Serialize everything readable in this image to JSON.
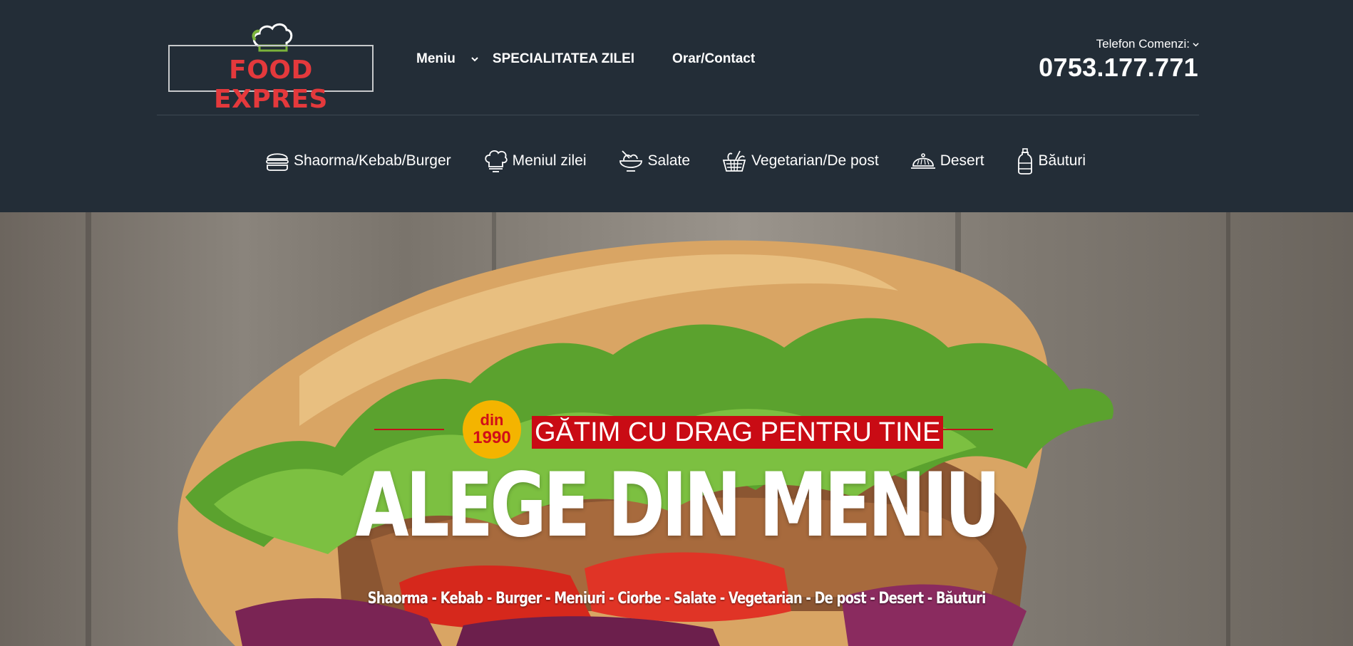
{
  "brand": {
    "name": "FOOD EXPRES",
    "logo_color": "#e4393c"
  },
  "main_nav": {
    "items": [
      {
        "label": "Meniu",
        "icon": "chevron-down-icon"
      },
      {
        "label": "SPECIALITATEA ZILEI"
      },
      {
        "label": "Orar/Contact"
      }
    ]
  },
  "contact": {
    "label": "Telefon Comenzi:",
    "phone": "0753.177.771"
  },
  "categories": [
    {
      "label": "Shaorma/Kebab/Burger",
      "icon": "burger-icon"
    },
    {
      "label": "Meniul zilei",
      "icon": "chef-hat-icon"
    },
    {
      "label": "Salate",
      "icon": "salad-bowl-icon"
    },
    {
      "label": "Vegetarian/De post",
      "icon": "vegetable-basket-icon"
    },
    {
      "label": "Desert",
      "icon": "cloche-icon"
    },
    {
      "label": "Băuturi",
      "icon": "bottle-icon"
    }
  ],
  "hero": {
    "badge_line1": "din",
    "badge_line2": "1990",
    "tagline": "GĂTIM CU DRAG PENTRU TINE",
    "headline": "ALEGE DIN MENIU",
    "subline": "Shaorma - Kebab - Burger - Meniuri - Ciorbe - Salate - Vegetarian - De post - Desert - Băuturi",
    "accent_color": "#c90b14",
    "badge_color": "#f4b400"
  },
  "colors": {
    "header_bg": "#232d37"
  }
}
